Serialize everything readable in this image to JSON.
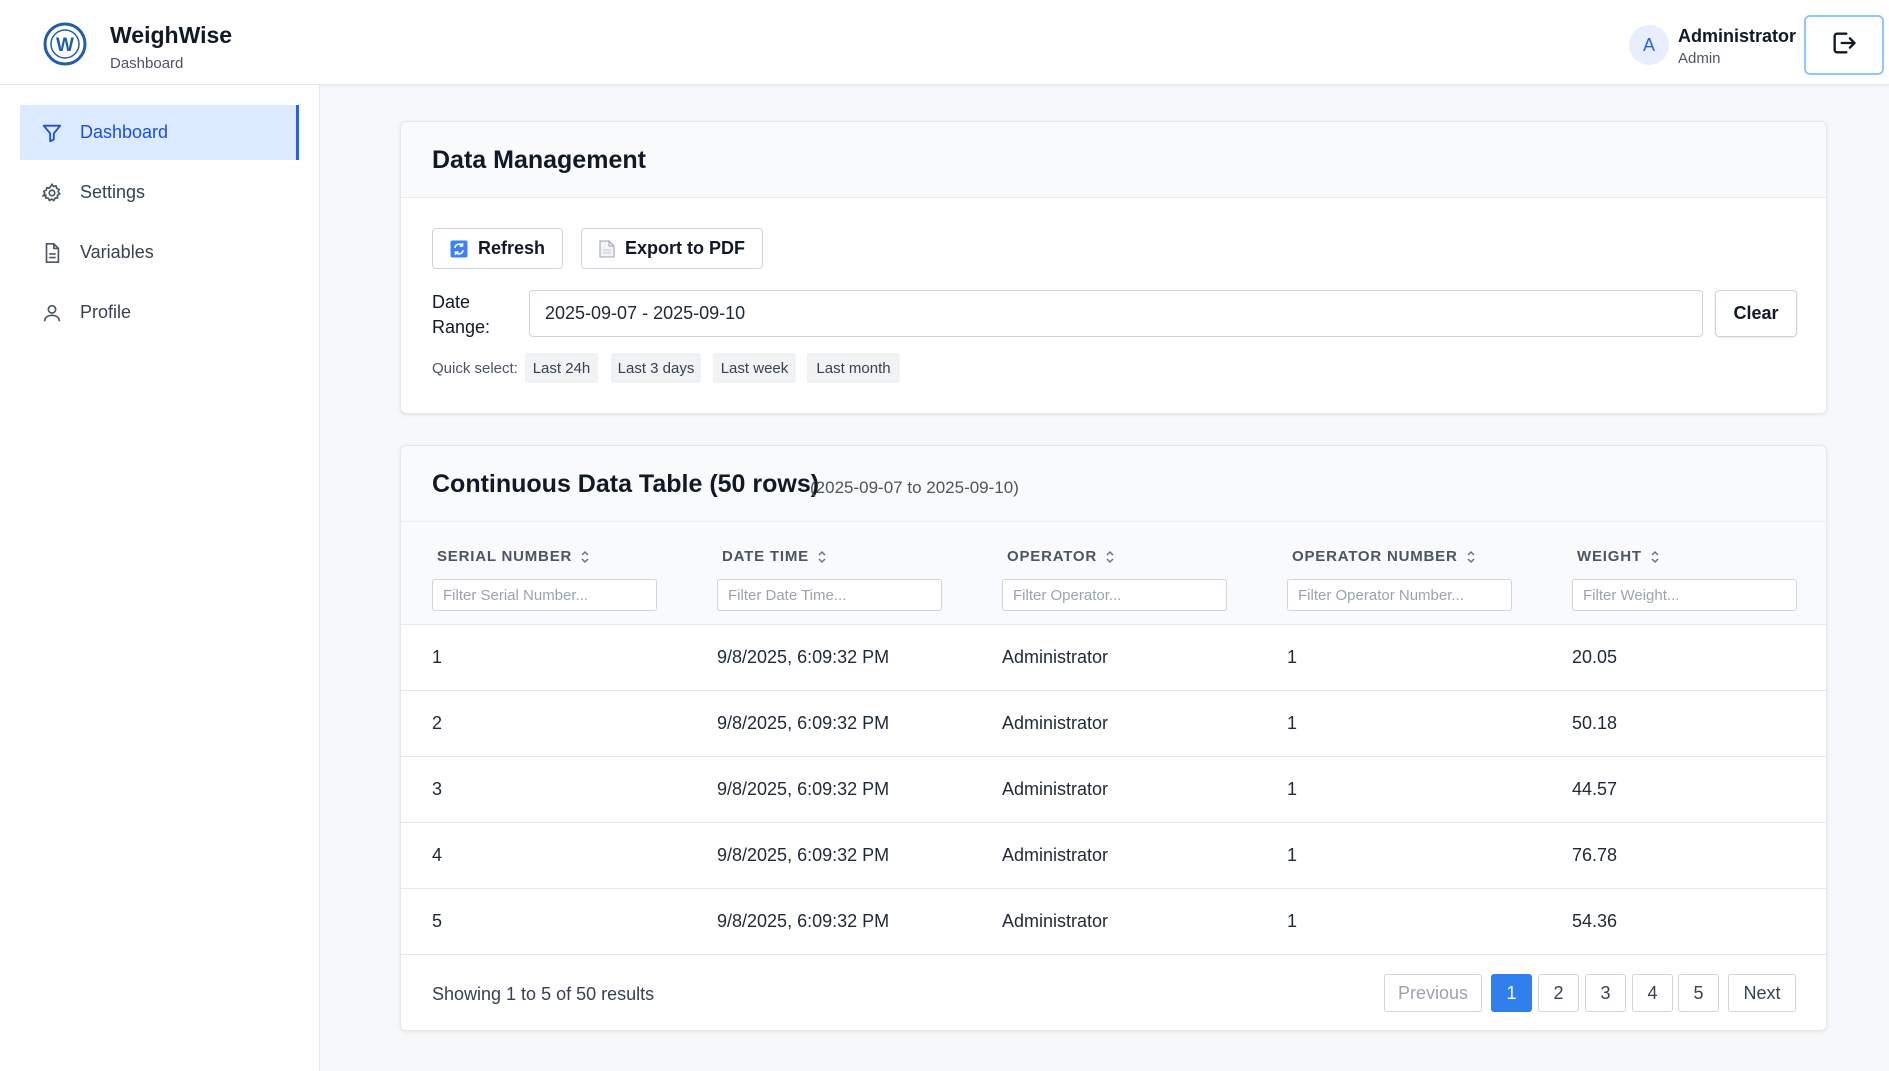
{
  "header": {
    "app_title": "WeighWise",
    "app_subtitle": "Dashboard",
    "logo_letter": "W",
    "avatar_letter": "A",
    "user_name": "Administrator",
    "user_role": "Admin",
    "logout_icon": "logout-icon"
  },
  "sidebar": {
    "items": [
      {
        "label": "Dashboard",
        "icon": "filter-icon",
        "active": true
      },
      {
        "label": "Settings",
        "icon": "gear-icon",
        "active": false
      },
      {
        "label": "Variables",
        "icon": "document-icon",
        "active": false
      },
      {
        "label": "Profile",
        "icon": "user-icon",
        "active": false
      }
    ]
  },
  "data_management": {
    "title": "Data Management",
    "refresh_label": "Refresh",
    "export_label": "Export to PDF",
    "date_range_label": "Date Range:",
    "date_range_value": "2025-09-07 - 2025-09-10",
    "clear_label": "Clear",
    "quick_select_label": "Quick select:",
    "quick_select": [
      "Last 24h",
      "Last 3 days",
      "Last week",
      "Last month"
    ]
  },
  "table": {
    "title": "Continuous Data Table (50 rows)",
    "range_text": "(2025-09-07 to 2025-09-10)",
    "columns": [
      "SERIAL NUMBER",
      "DATE TIME",
      "OPERATOR",
      "OPERATOR NUMBER",
      "WEIGHT"
    ],
    "filter_placeholders": [
      "Filter Serial Number...",
      "Filter Date Time...",
      "Filter Operator...",
      "Filter Operator Number...",
      "Filter Weight..."
    ],
    "rows": [
      [
        "1",
        "9/8/2025, 6:09:32 PM",
        "Administrator",
        "1",
        "20.05"
      ],
      [
        "2",
        "9/8/2025, 6:09:32 PM",
        "Administrator",
        "1",
        "50.18"
      ],
      [
        "3",
        "9/8/2025, 6:09:32 PM",
        "Administrator",
        "1",
        "44.57"
      ],
      [
        "4",
        "9/8/2025, 6:09:32 PM",
        "Administrator",
        "1",
        "76.78"
      ],
      [
        "5",
        "9/8/2025, 6:09:32 PM",
        "Administrator",
        "1",
        "54.36"
      ]
    ],
    "showing_text": "Showing 1 to 5 of 50 results"
  },
  "pagination": {
    "previous_label": "Previous",
    "pages": [
      "1",
      "2",
      "3",
      "4",
      "5"
    ],
    "current_page": "1",
    "next_label": "Next"
  },
  "colors": {
    "accent": "#2f80ed",
    "active_nav_bg": "#dbeafe",
    "active_nav_text": "#1d4ed8"
  }
}
